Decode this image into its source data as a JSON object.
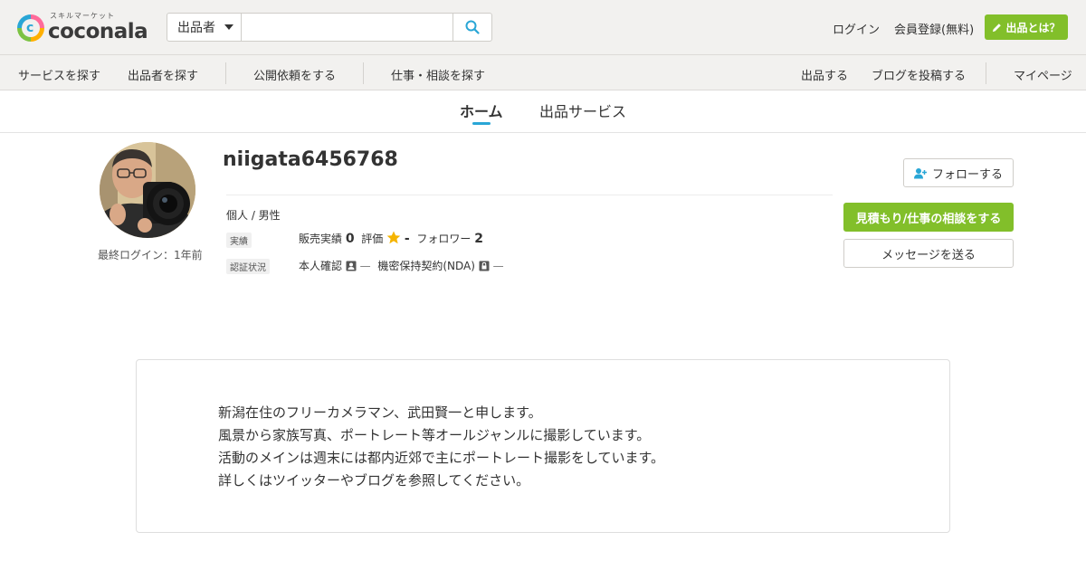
{
  "header": {
    "logo_sub": "スキルマーケット",
    "logo_main": "coconala",
    "search_select": "出品者",
    "search_placeholder": "",
    "login": "ログイン",
    "register": "会員登録(無料)",
    "sell_button": "出品とは？"
  },
  "subnav": {
    "items": [
      "サービスを探す",
      "出品者を探す",
      "公開依頼をする",
      "仕事・相談を探す"
    ],
    "right_items": [
      "出品する",
      "ブログを投稿する",
      "マイページ"
    ]
  },
  "tabs": [
    {
      "label": "ホーム",
      "active": true
    },
    {
      "label": "出品サービス",
      "active": false
    }
  ],
  "profile": {
    "username": "niigata6456768",
    "last_login": "最終ログイン：1年前",
    "follow_button": "フォローする",
    "attributes": "個人 / 男性",
    "record_label": "実績",
    "sales_label": "販売実績",
    "sales_value": "0",
    "rating_label": "評価",
    "rating_value": "-",
    "followers_label": "フォロワー",
    "followers_value": "2",
    "verification_label": "認証状況",
    "identity_label": "本人確認",
    "identity_status": "—",
    "nda_label": "機密保持契約(NDA)",
    "nda_status": "—",
    "consult_button": "見積もり/仕事の相談をする",
    "message_button": "メッセージを送る"
  },
  "bio": {
    "lines": [
      "新潟在住のフリーカメラマン、武田賢一と申します。",
      "風景から家族写真、ポートレート等オールジャンルに撮影しています。",
      "活動のメインは週末には都内近郊で主にポートレート撮影をしています。",
      "詳しくはツイッターやブログを参照してください。"
    ]
  },
  "colors": {
    "accent_green": "#82bf2a",
    "accent_blue": "#29a6d6",
    "star_yellow": "#f5b400"
  }
}
